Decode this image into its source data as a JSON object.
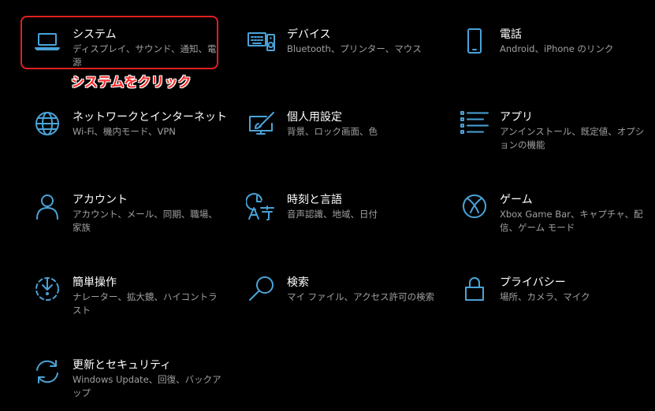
{
  "annotation": {
    "callout": "システムをクリック",
    "highlight_color": "#e02020"
  },
  "accent_color": "#4aa3d8",
  "tiles": [
    {
      "icon": "laptop-icon",
      "title": "システム",
      "desc": "ディスプレイ、サウンド、通知、電源"
    },
    {
      "icon": "keyboard-speaker-icon",
      "title": "デバイス",
      "desc": "Bluetooth、プリンター、マウス"
    },
    {
      "icon": "phone-icon",
      "title": "電話",
      "desc": "Android、iPhone のリンク"
    },
    {
      "icon": "globe-icon",
      "title": "ネットワークとインターネット",
      "desc": "Wi-Fi、機内モード、VPN"
    },
    {
      "icon": "paint-brush-icon",
      "title": "個人用設定",
      "desc": "背景、ロック画面、色"
    },
    {
      "icon": "apps-list-icon",
      "title": "アプリ",
      "desc": "アンインストール、既定値、オプションの機能"
    },
    {
      "icon": "person-icon",
      "title": "アカウント",
      "desc": "アカウント、メール、同期、職場、家族"
    },
    {
      "icon": "time-language-icon",
      "title": "時刻と言語",
      "desc": "音声認識、地域、日付"
    },
    {
      "icon": "xbox-icon",
      "title": "ゲーム",
      "desc": "Xbox Game Bar、キャプチャ、配信、ゲーム モード"
    },
    {
      "icon": "ease-of-access-icon",
      "title": "簡単操作",
      "desc": "ナレーター、拡大鏡、ハイコントラスト"
    },
    {
      "icon": "search-icon",
      "title": "検索",
      "desc": "マイ ファイル、アクセス許可の検索"
    },
    {
      "icon": "lock-icon",
      "title": "プライバシー",
      "desc": "場所、カメラ、マイク"
    },
    {
      "icon": "update-icon",
      "title": "更新とセキュリティ",
      "desc": "Windows Update、回復、バックアップ"
    }
  ]
}
